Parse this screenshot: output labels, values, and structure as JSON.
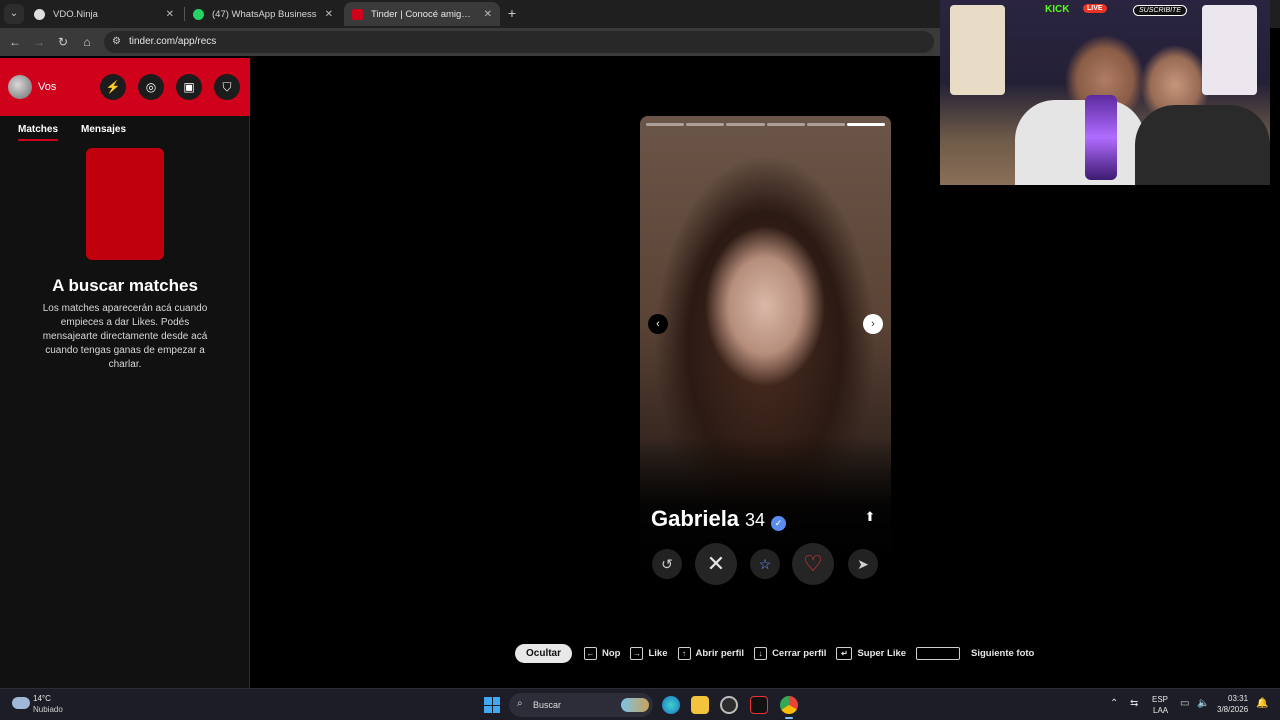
{
  "browser": {
    "tabs": [
      {
        "title": "VDO.Ninja",
        "favicon_color": "#dddddd",
        "active": false
      },
      {
        "title": "(47) WhatsApp Business",
        "favicon_color": "#25d366",
        "active": false
      },
      {
        "title": "Tinder | Conocé amigos y gente nueva",
        "favicon_color": "#d0021b",
        "active": true
      }
    ],
    "new_tab": "+",
    "url": "tinder.com/app/recs"
  },
  "sidebar": {
    "user_label": "Vos",
    "tabs": [
      {
        "label": "Matches",
        "active": true
      },
      {
        "label": "Mensajes",
        "active": false
      }
    ],
    "empty_title": "A buscar matches",
    "empty_text": "Los matches aparecerán acá cuando empieces a dar Likes. Podés mensajearte directamente desde acá cuando tengas ganas de empezar a charlar.",
    "brand_color": "#d0021b"
  },
  "card": {
    "name": "Gabriela",
    "age": "34",
    "verified": true,
    "photo_count": 6,
    "current_photo_index": 5,
    "action_icons": [
      "rewind-icon",
      "nope-icon",
      "super-like-icon",
      "like-icon",
      "boost-icon"
    ]
  },
  "hints": {
    "hide_label": "Ocultar",
    "nope": "Nop",
    "like": "Like",
    "open_profile": "Abrir perfil",
    "close_profile": "Cerrar perfil",
    "super_like": "Super Like",
    "next_photo": "Siguiente foto"
  },
  "stream_overlay": {
    "kick_label": "KICK",
    "live_label": "LIVE",
    "subscribe_label": "SUSCRIBITE"
  },
  "taskbar": {
    "temperature": "14°C",
    "condition": "Nubiado",
    "search_label": "Buscar",
    "language_top": "ESP",
    "language_bottom": "LAA",
    "time": "03:31",
    "date": "3/8/2026"
  }
}
